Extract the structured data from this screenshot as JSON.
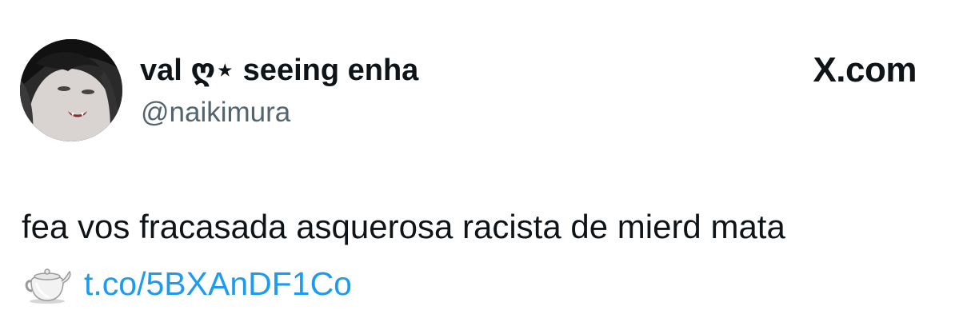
{
  "tweet": {
    "author": {
      "display_name": "val ღ⋆ seeing enha",
      "handle": "@naikimura",
      "avatar": "profile-photo"
    },
    "brand": "X.com",
    "text": "fea vos fracasada asquerosa racista de mierd mata",
    "link": {
      "emoji": "🫖",
      "emoji_icon": "teapot-icon",
      "text": "t.co/5BXAnDF1Co"
    }
  },
  "colors": {
    "text": "#0f1419",
    "secondary_text": "#536471",
    "link": "#1d9bf0",
    "background": "#ffffff"
  }
}
